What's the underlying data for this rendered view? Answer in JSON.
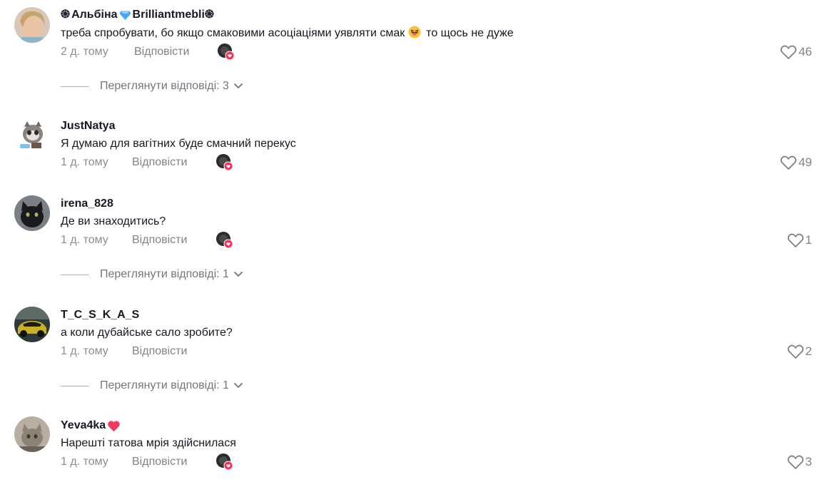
{
  "comments": [
    {
      "username_prefix": "֍",
      "username": "Альбіна",
      "username_suffix": "Brilliantmebli֍",
      "text": "треба спробувати, бо якщо смаковими асоціаціями уявляти смак",
      "text_after_emoji": "то щось не дуже",
      "time": "2 д. тому",
      "reply_label": "Відповісти",
      "likes": "46",
      "view_replies": "Переглянути відповіді: 3"
    },
    {
      "username": "JustNatya",
      "text": "Я думаю для вагітних буде смачний перекус",
      "time": "1 д. тому",
      "reply_label": "Відповісти",
      "likes": "49"
    },
    {
      "username": "irena_828",
      "text": "Де ви знаходитись?",
      "time": "1 д. тому",
      "reply_label": "Відповісти",
      "likes": "1",
      "view_replies": "Переглянути відповіді: 1"
    },
    {
      "username": "T_C_S_K_A_S",
      "text": "а коли дубайське сало зробите?",
      "time": "1 д. тому",
      "reply_label": "Відповісти",
      "likes": "2",
      "view_replies": "Переглянути відповіді: 1"
    },
    {
      "username": "Yeva4ka",
      "text": "Нарешті татова мрія здійснилася",
      "time": "1 д. тому",
      "reply_label": "Відповісти",
      "likes": "3"
    }
  ],
  "icons": {
    "like": "heart-outline-icon",
    "expand": "chevron-down-icon",
    "creator_liked": "creator-liked-avatar-icon",
    "badge": "diamond-emoji-icon",
    "heart_badge": "heart-emoji-icon",
    "emoji": "grinning-tongue-emoji-icon"
  },
  "colors": {
    "text": "#161823",
    "muted": "#8a8b91",
    "accent_pink": "#fe2c55",
    "diamond": "#3fa9f5"
  }
}
